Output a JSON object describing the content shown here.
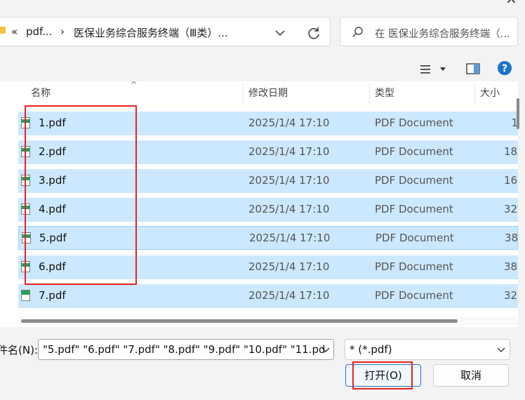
{
  "window": {
    "close_glyph": "×"
  },
  "address_bar": {
    "prefix": "«",
    "crumbs": [
      "pdf...",
      "医保业务综合服务终端（Ⅲ类）..."
    ],
    "separator": "›"
  },
  "search": {
    "placeholder": "在 医保业务综合服务终端（..."
  },
  "columns": {
    "name": "名称",
    "modified": "修改日期",
    "type": "类型",
    "size": "大小"
  },
  "files": [
    {
      "name": "1.pdf",
      "date": "2025/1/4 17:10",
      "type": "PDF Document",
      "size": "1",
      "selected": true
    },
    {
      "name": "2.pdf",
      "date": "2025/1/4 17:10",
      "type": "PDF Document",
      "size": "18",
      "selected": true
    },
    {
      "name": "3.pdf",
      "date": "2025/1/4 17:10",
      "type": "PDF Document",
      "size": "16",
      "selected": true
    },
    {
      "name": "4.pdf",
      "date": "2025/1/4 17:10",
      "type": "PDF Document",
      "size": "32",
      "selected": true
    },
    {
      "name": "5.pdf",
      "date": "2025/1/4 17:10",
      "type": "PDF Document",
      "size": "38",
      "selected": true
    },
    {
      "name": "6.pdf",
      "date": "2025/1/4 17:10",
      "type": "PDF Document",
      "size": "38",
      "selected": true
    },
    {
      "name": "7.pdf",
      "date": "2025/1/4 17:10",
      "type": "PDF Document",
      "size": "32",
      "selected": true
    }
  ],
  "file_name": {
    "label": "件名(N):",
    "value": "\"5.pdf\" \"6.pdf\" \"7.pdf\" \"8.pdf\" \"9.pdf\" \"10.pdf\" \"11.pd"
  },
  "filter": {
    "value": "* (*.pdf)"
  },
  "buttons": {
    "open": "打开(O)",
    "cancel": "取消"
  },
  "colors": {
    "selection": "#cce8ff",
    "accent": "#2f74c6",
    "annotation": "#e8231f",
    "help": "#1a73c9"
  },
  "icons": [
    "folder-icon",
    "chevron-down-icon",
    "refresh-icon",
    "search-icon",
    "view-menu-icon",
    "preview-pane-icon",
    "help-icon",
    "pdf-file-icon"
  ]
}
